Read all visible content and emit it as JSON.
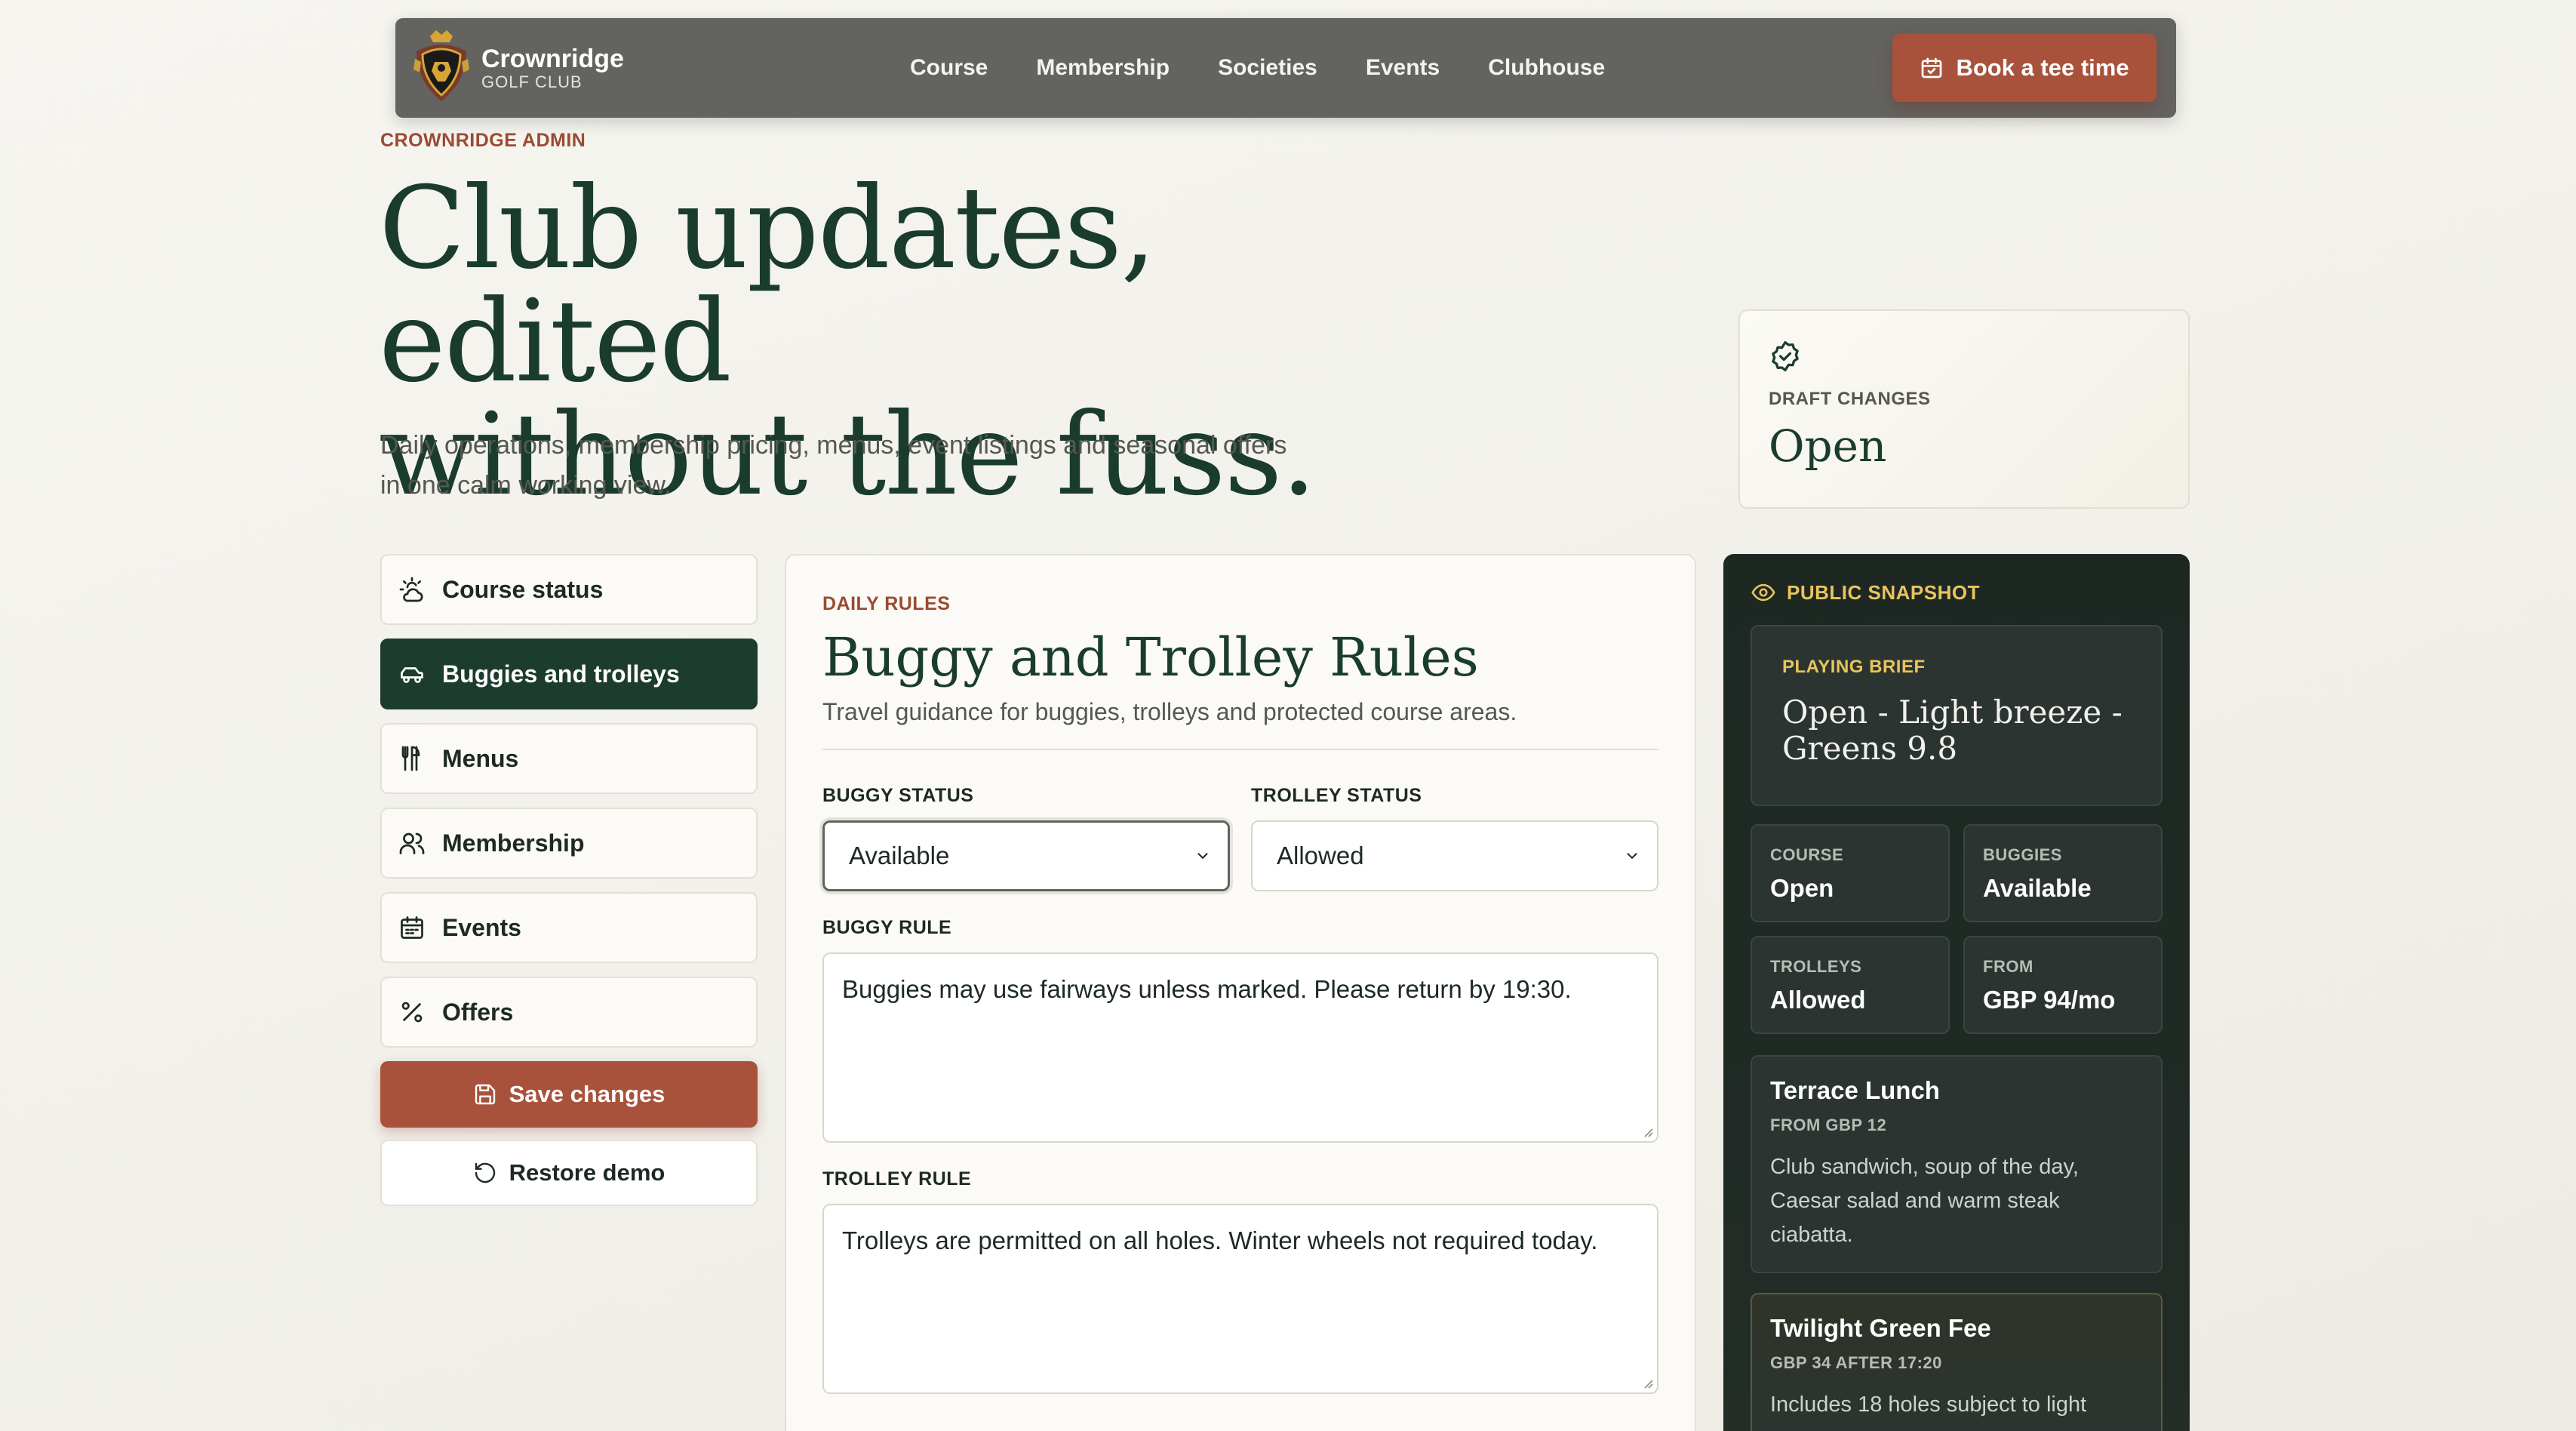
{
  "nav": {
    "brand_name": "Crownridge",
    "brand_sub": "GOLF CLUB",
    "links": [
      "Course",
      "Membership",
      "Societies",
      "Events",
      "Clubhouse"
    ],
    "book_label": "Book a tee time"
  },
  "hero": {
    "eyebrow": "CROWNRIDGE ADMIN",
    "title_line1": "Club updates, edited",
    "title_line2": "without the fuss.",
    "subtitle_line1": "Daily operations, membership pricing, menus, event listings and seasonal offers",
    "subtitle_line2": "in one calm working view."
  },
  "draft": {
    "label": "DRAFT CHANGES",
    "value": "Open"
  },
  "sidebar": {
    "items": [
      {
        "label": "Course status",
        "icon": "sun-cloud-icon",
        "active": false
      },
      {
        "label": "Buggies and trolleys",
        "icon": "buggy-icon",
        "active": true
      },
      {
        "label": "Menus",
        "icon": "utensils-icon",
        "active": false
      },
      {
        "label": "Membership",
        "icon": "users-icon",
        "active": false
      },
      {
        "label": "Events",
        "icon": "calendar-icon",
        "active": false
      },
      {
        "label": "Offers",
        "icon": "percent-icon",
        "active": false
      }
    ],
    "save_label": "Save changes",
    "restore_label": "Restore demo"
  },
  "editor": {
    "eyebrow": "DAILY RULES",
    "title": "Buggy and Trolley Rules",
    "subtitle": "Travel guidance for buggies, trolleys and protected course areas.",
    "buggy_status_label": "BUGGY STATUS",
    "buggy_status_value": "Available",
    "trolley_status_label": "TROLLEY STATUS",
    "trolley_status_value": "Allowed",
    "buggy_rule_label": "BUGGY RULE",
    "buggy_rule_value": "Buggies may use fairways unless marked. Please return by 19:30.",
    "trolley_rule_label": "TROLLEY RULE",
    "trolley_rule_value": "Trolleys are permitted on all holes. Winter wheels not required today."
  },
  "snapshot": {
    "header": "PUBLIC SNAPSHOT",
    "brief_label": "PLAYING BRIEF",
    "brief_line1": "Open - Light breeze -",
    "brief_line2": "Greens 9.8",
    "tiles": [
      {
        "label": "COURSE",
        "value": "Open"
      },
      {
        "label": "BUGGIES",
        "value": "Available"
      },
      {
        "label": "TROLLEYS",
        "value": "Allowed"
      },
      {
        "label": "FROM",
        "value": "GBP 94/mo"
      }
    ],
    "cards": [
      {
        "title": "Terrace Lunch",
        "meta": "FROM GBP 12",
        "desc_line1": "Club sandwich, soup of the day,",
        "desc_line2": "Caesar salad and warm steak",
        "desc_line3": "ciabatta."
      },
      {
        "title": "Twilight Green Fee",
        "meta": "GBP 34 AFTER 17:20",
        "desc_line1": "Includes 18 holes subject to light"
      }
    ]
  },
  "colors": {
    "accent": "#a8523c",
    "forest": "#1c3c2e",
    "gold": "#e9c45c",
    "nav_bg": "#636360"
  }
}
